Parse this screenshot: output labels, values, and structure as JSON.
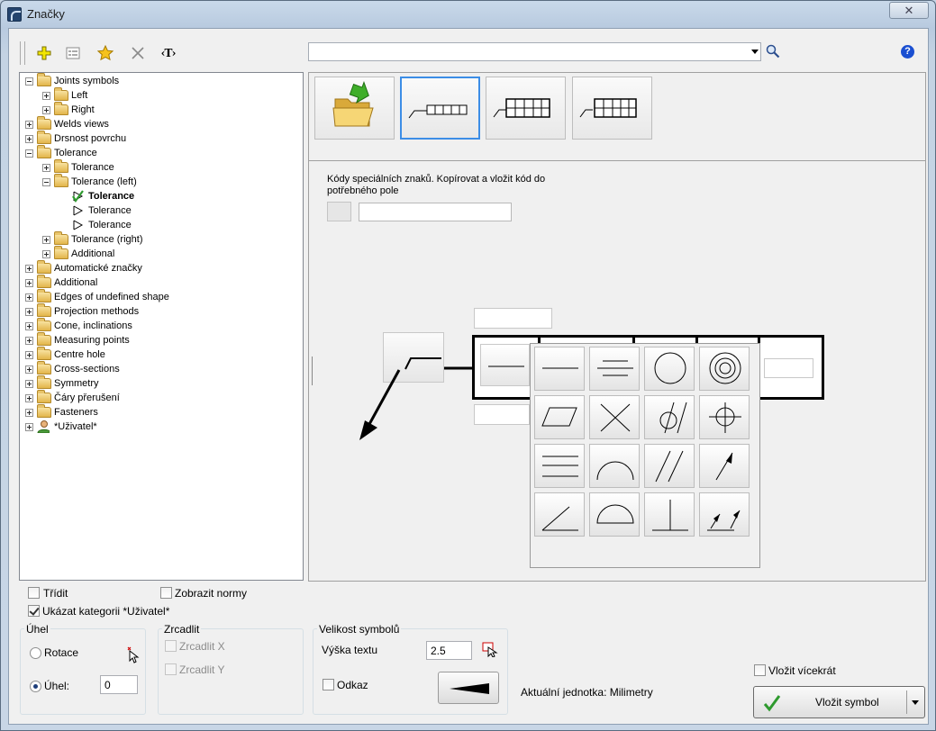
{
  "window": {
    "title": "Značky",
    "close_label": "✕"
  },
  "toolbar": {
    "buttons": [
      {
        "name": "add-icon",
        "tooltip": ""
      },
      {
        "name": "properties-icon"
      },
      {
        "name": "favorite-star-icon"
      },
      {
        "name": "delete-icon"
      },
      {
        "name": "text-tag-icon",
        "label": "‹T›"
      }
    ],
    "search": {
      "value": "",
      "placeholder": ""
    },
    "help_label": "?"
  },
  "tree": {
    "items": [
      {
        "label": "Joints symbols",
        "level": 0,
        "expander": "minus",
        "icon": "folder"
      },
      {
        "label": "Left",
        "level": 1,
        "expander": "plus",
        "icon": "folder"
      },
      {
        "label": "Right",
        "level": 1,
        "expander": "plus",
        "icon": "folder"
      },
      {
        "label": "Welds views",
        "level": 0,
        "expander": "plus",
        "icon": "folder"
      },
      {
        "label": "Drsnost povrchu",
        "level": 0,
        "expander": "plus",
        "icon": "folder"
      },
      {
        "label": "Tolerance",
        "level": 0,
        "expander": "minus",
        "icon": "folder"
      },
      {
        "label": "Tolerance",
        "level": 1,
        "expander": "plus",
        "icon": "folder"
      },
      {
        "label": "Tolerance (left)",
        "level": 1,
        "expander": "minus",
        "icon": "folder"
      },
      {
        "label": "Tolerance",
        "level": 2,
        "expander": "none",
        "icon": "tolerance-check",
        "selected": true
      },
      {
        "label": "Tolerance",
        "level": 2,
        "expander": "none",
        "icon": "tolerance-flag"
      },
      {
        "label": "Tolerance",
        "level": 2,
        "expander": "none",
        "icon": "tolerance-flag"
      },
      {
        "label": "Tolerance (right)",
        "level": 1,
        "expander": "plus",
        "icon": "folder"
      },
      {
        "label": "Additional",
        "level": 1,
        "expander": "plus",
        "icon": "folder"
      },
      {
        "label": "Automatické značky",
        "level": 0,
        "expander": "plus",
        "icon": "folder"
      },
      {
        "label": "Additional",
        "level": 0,
        "expander": "plus",
        "icon": "folder"
      },
      {
        "label": "Edges of undefined shape",
        "level": 0,
        "expander": "plus",
        "icon": "folder"
      },
      {
        "label": "Projection methods",
        "level": 0,
        "expander": "plus",
        "icon": "folder"
      },
      {
        "label": "Cone, inclinations",
        "level": 0,
        "expander": "plus",
        "icon": "folder"
      },
      {
        "label": "Measuring points",
        "level": 0,
        "expander": "plus",
        "icon": "folder"
      },
      {
        "label": "Centre hole",
        "level": 0,
        "expander": "plus",
        "icon": "folder"
      },
      {
        "label": "Cross-sections",
        "level": 0,
        "expander": "plus",
        "icon": "folder"
      },
      {
        "label": "Symmetry",
        "level": 0,
        "expander": "plus",
        "icon": "folder"
      },
      {
        "label": "Čáry přerušení",
        "level": 0,
        "expander": "plus",
        "icon": "folder"
      },
      {
        "label": "Fasteners",
        "level": 0,
        "expander": "plus",
        "icon": "folder"
      },
      {
        "label": "*Uživatel*",
        "level": 0,
        "expander": "plus",
        "icon": "user"
      }
    ]
  },
  "preview": {
    "thumbnails": [
      {
        "name": "open-folder-thumbnail"
      },
      {
        "name": "tolerance-frame-1-row-thumbnail",
        "selected": true
      },
      {
        "name": "tolerance-frame-2-rows-thumbnail"
      },
      {
        "name": "tolerance-frame-2-rows-alt-thumbnail"
      }
    ],
    "codes_text": "Kódy speciálních znaků. Kopírovat a vložit kód do potřebného pole",
    "code_value": ""
  },
  "palette": {
    "symbols": [
      "straightness",
      "flatness",
      "circularity",
      "cylindricity",
      "parallelogram",
      "cross",
      "diameter-slash",
      "position",
      "parallelism",
      "arc-profile",
      "parallel-diagonal",
      "runout",
      "angularity",
      "half-circle",
      "perpendicularity",
      "total-runout"
    ]
  },
  "options": {
    "sort_label": "Třídit",
    "sort_checked": false,
    "show_norms_label": "Zobrazit normy",
    "show_norms_checked": false,
    "show_user_category_label": "Ukázat kategorii *Uživatel*",
    "show_user_category_checked": true
  },
  "angle_group": {
    "title": "Úhel",
    "rotation_label": "Rotace",
    "angle_label": "Úhel:",
    "angle_value": "0",
    "selected": "angle"
  },
  "mirror_group": {
    "title": "Zrcadlit",
    "mirror_x_label": "Zrcadlit X",
    "mirror_y_label": "Zrcadlit Y"
  },
  "size_group": {
    "title": "Velikost symbolů",
    "text_height_label": "Výška textu",
    "text_height_value": "2.5",
    "reference_label": "Odkaz",
    "reference_checked": false
  },
  "status": {
    "current_unit": "Aktuální jednotka: Milimetry"
  },
  "insert": {
    "insert_multiple_label": "Vložit vícekrát",
    "insert_multiple_checked": false,
    "insert_symbol_label": "Vložit symbol"
  },
  "colors": {
    "accent": "#3c8de6",
    "help": "#1a4fd1",
    "check_green": "#2e9a2e"
  }
}
